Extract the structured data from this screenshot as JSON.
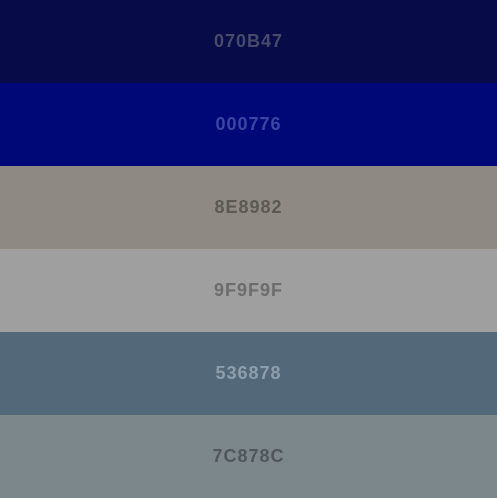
{
  "swatches": [
    {
      "code": "070B47",
      "color": "#070B47",
      "text_color": "#4a4f6f"
    },
    {
      "code": "000776",
      "color": "#000776",
      "text_color": "#3e4aa6"
    },
    {
      "code": "8E8982",
      "color": "#8E8982",
      "text_color": "#5a5651"
    },
    {
      "code": "9F9F9F",
      "color": "#9F9F9F",
      "text_color": "#6a6a6a"
    },
    {
      "code": "536878",
      "color": "#536878",
      "text_color": "#8fa2b2"
    },
    {
      "code": "7C878C",
      "color": "#7C878C",
      "text_color": "#4d5559"
    }
  ]
}
